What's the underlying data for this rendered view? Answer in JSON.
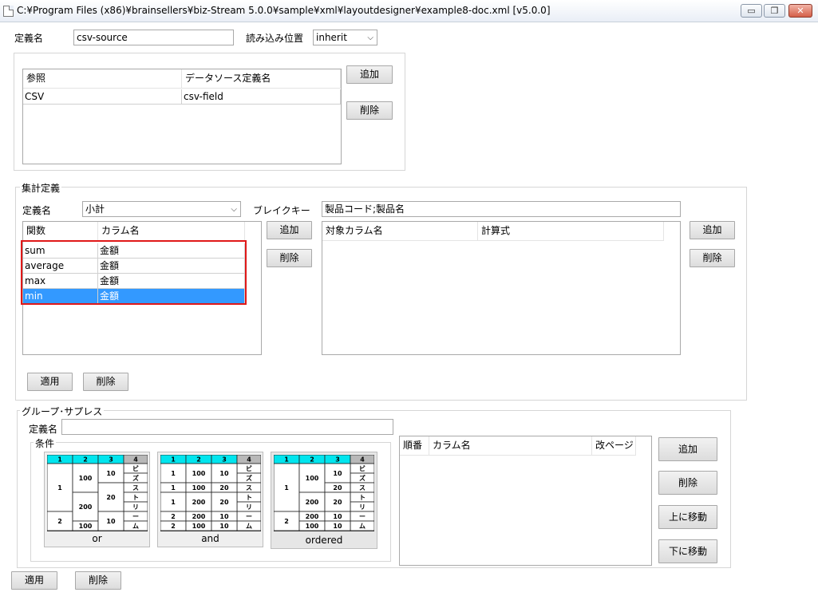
{
  "window": {
    "title": "C:¥Program Files (x86)¥brainsellers¥biz-Stream 5.0.0¥sample¥xml¥layoutdesigner¥example8-doc.xml [v5.0.0]",
    "buttons": {
      "minimize": "▭",
      "restore": "❐",
      "close": "✕"
    }
  },
  "source": {
    "name_label": "定義名",
    "name_value": "csv-source",
    "position_label": "読み込み位置",
    "position_value": "inherit",
    "ref_table": {
      "headers": [
        "参照",
        "データソース定義名"
      ],
      "rows": [
        [
          "CSV",
          "csv-field"
        ]
      ]
    },
    "add_label": "追加",
    "delete_label": "削除"
  },
  "aggregation": {
    "legend": "集計定義",
    "name_label": "定義名",
    "name_value": "小計",
    "breakkey_label": "ブレイクキー",
    "breakkey_value": "製品コード;製品名",
    "func_table": {
      "headers": [
        "関数",
        "カラム名"
      ],
      "rows": [
        [
          "sum",
          "金額"
        ],
        [
          "average",
          "金額"
        ],
        [
          "max",
          "金額"
        ],
        [
          "min",
          "金額"
        ]
      ],
      "selected_row": 3
    },
    "target_table": {
      "headers": [
        "対象カラム名",
        "計算式"
      ]
    },
    "add_label": "追加",
    "delete_label": "削除",
    "apply_label": "適用",
    "bottom_delete_label": "削除"
  },
  "group_suppress": {
    "legend": "グループ･サプレス",
    "name_label": "定義名",
    "name_value": "",
    "condition_legend": "条件",
    "conditions": [
      {
        "caption": "or",
        "header": [
          "1",
          "2",
          "3",
          "4"
        ],
        "side": [
          "ビ",
          "ズ",
          "ス",
          "ト",
          "リ",
          "ー",
          "ム"
        ],
        "c1": [
          "1",
          "2"
        ],
        "c2": [
          "100",
          "200",
          "100"
        ],
        "c3": [
          "10",
          "20",
          "10"
        ]
      },
      {
        "caption": "and",
        "header": [
          "1",
          "2",
          "3",
          "4"
        ],
        "side": [
          "ビ",
          "ズ",
          "ス",
          "ト",
          "リ",
          "ー",
          "ム"
        ],
        "c1": [
          "1",
          "1",
          "1",
          "2",
          "2"
        ],
        "c2": [
          "100",
          "100",
          "200",
          "200",
          "100"
        ],
        "c3": [
          "10",
          "20",
          "20",
          "10",
          "10"
        ]
      },
      {
        "caption": "ordered",
        "header": [
          "1",
          "2",
          "3",
          "4"
        ],
        "side": [
          "ビ",
          "ズ",
          "ス",
          "ト",
          "リ",
          "ー",
          "ム"
        ],
        "c1": [
          "1",
          "2"
        ],
        "c2": [
          "100",
          "200",
          "200",
          "100"
        ],
        "c3": [
          "10",
          "20",
          "20",
          "10",
          "10"
        ]
      }
    ],
    "order_table": {
      "headers": [
        "順番",
        "カラム名",
        "改ページ"
      ]
    },
    "add_label": "追加",
    "delete_label": "削除",
    "move_up_label": "上に移動",
    "move_down_label": "下に移動"
  },
  "footer": {
    "apply_label": "適用",
    "delete_label": "削除"
  },
  "colors": {
    "accent": "#00e5ee",
    "selection": "#3399ff",
    "highlight": "#e01818"
  }
}
